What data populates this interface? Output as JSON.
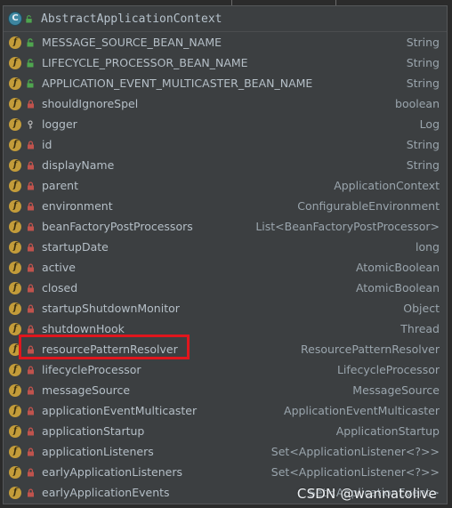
{
  "header": {
    "class_icon_letter": "C",
    "title": "AbstractApplicationContext"
  },
  "colors": {
    "field_icon": "#c39c3a",
    "class_icon": "#3e86a0",
    "highlight_border": "#e0161d",
    "lock": "#c0534d",
    "public_unlock": "#4fa64f"
  },
  "fields": [
    {
      "name": "MESSAGE_SOURCE_BEAN_NAME",
      "type": "String",
      "modifier": "public-static-icon"
    },
    {
      "name": "LIFECYCLE_PROCESSOR_BEAN_NAME",
      "type": "String",
      "modifier": "public-static-icon"
    },
    {
      "name": "APPLICATION_EVENT_MULTICASTER_BEAN_NAME",
      "type": "String",
      "modifier": "public-static-icon"
    },
    {
      "name": "shouldIgnoreSpel",
      "type": "boolean",
      "modifier": "lock-icon"
    },
    {
      "name": "logger",
      "type": "Log",
      "modifier": "key-icon"
    },
    {
      "name": "id",
      "type": "String",
      "modifier": "lock-icon"
    },
    {
      "name": "displayName",
      "type": "String",
      "modifier": "lock-icon"
    },
    {
      "name": "parent",
      "type": "ApplicationContext",
      "modifier": "lock-icon"
    },
    {
      "name": "environment",
      "type": "ConfigurableEnvironment",
      "modifier": "lock-icon"
    },
    {
      "name": "beanFactoryPostProcessors",
      "type": "List<BeanFactoryPostProcessor>",
      "modifier": "lock-icon"
    },
    {
      "name": "startupDate",
      "type": "long",
      "modifier": "lock-icon"
    },
    {
      "name": "active",
      "type": "AtomicBoolean",
      "modifier": "lock-icon"
    },
    {
      "name": "closed",
      "type": "AtomicBoolean",
      "modifier": "lock-icon"
    },
    {
      "name": "startupShutdownMonitor",
      "type": "Object",
      "modifier": "lock-icon"
    },
    {
      "name": "shutdownHook",
      "type": "Thread",
      "modifier": "lock-icon"
    },
    {
      "name": "resourcePatternResolver",
      "type": "ResourcePatternResolver",
      "modifier": "lock-icon",
      "highlighted": true
    },
    {
      "name": "lifecycleProcessor",
      "type": "LifecycleProcessor",
      "modifier": "lock-icon"
    },
    {
      "name": "messageSource",
      "type": "MessageSource",
      "modifier": "lock-icon"
    },
    {
      "name": "applicationEventMulticaster",
      "type": "ApplicationEventMulticaster",
      "modifier": "lock-icon"
    },
    {
      "name": "applicationStartup",
      "type": "ApplicationStartup",
      "modifier": "lock-icon"
    },
    {
      "name": "applicationListeners",
      "type": "Set<ApplicationListener<?>>",
      "modifier": "lock-icon"
    },
    {
      "name": "earlyApplicationListeners",
      "type": "Set<ApplicationListener<?>>",
      "modifier": "lock-icon"
    },
    {
      "name": "earlyApplicationEvents",
      "type": "Set<ApplicationEvent>",
      "modifier": "lock-icon"
    }
  ],
  "watermark": "CSDN @wannatolive"
}
